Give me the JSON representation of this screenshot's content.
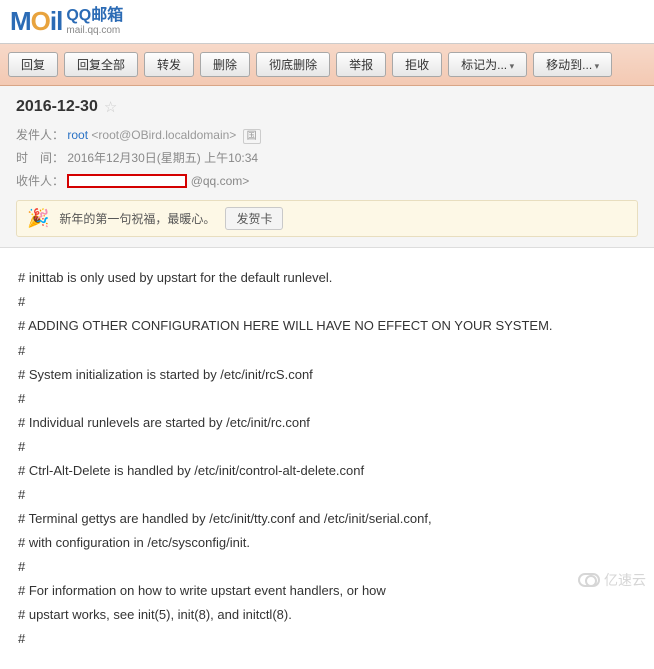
{
  "header": {
    "logo_mail_prefix": "M",
    "logo_mail_o": "O",
    "logo_mail_suffix": "il",
    "brand_cn": "QQ邮箱",
    "brand_en": "mail.qq.com"
  },
  "toolbar": {
    "reply": "回复",
    "reply_all": "回复全部",
    "forward": "转发",
    "delete": "删除",
    "delete_perm": "彻底删除",
    "report": "举报",
    "reject": "拒收",
    "mark_as": "标记为...",
    "move_to": "移动到..."
  },
  "meta": {
    "subject": "2016-12-30",
    "sender_label": "发件人：",
    "sender_name": "root",
    "sender_addr": "<root@OBird.localdomain>",
    "addr_book": "国",
    "date_label": "时　间：",
    "date_value": "2016年12月30日(星期五) 上午10:34",
    "recipient_label": "收件人：",
    "recipient_domain": "@qq.com>"
  },
  "promo": {
    "text": "新年的第一句祝福，最暖心。",
    "button": "发贺卡"
  },
  "body_lines": [
    "# inittab is only used by upstart for the default runlevel.",
    "#",
    "# ADDING OTHER CONFIGURATION HERE WILL HAVE NO EFFECT ON YOUR SYSTEM.",
    "#",
    "# System initialization is started by /etc/init/rcS.conf",
    "#",
    "# Individual runlevels are started by /etc/init/rc.conf",
    "#",
    "# Ctrl-Alt-Delete is handled by /etc/init/control-alt-delete.conf",
    "#",
    "# Terminal gettys are handled by /etc/init/tty.conf and /etc/init/serial.conf,",
    "# with configuration in /etc/sysconfig/init.",
    "#",
    "# For information on how to write upstart event handlers, or how",
    "# upstart works, see init(5), init(8), and initctl(8).",
    "#"
  ],
  "watermark": "亿速云"
}
